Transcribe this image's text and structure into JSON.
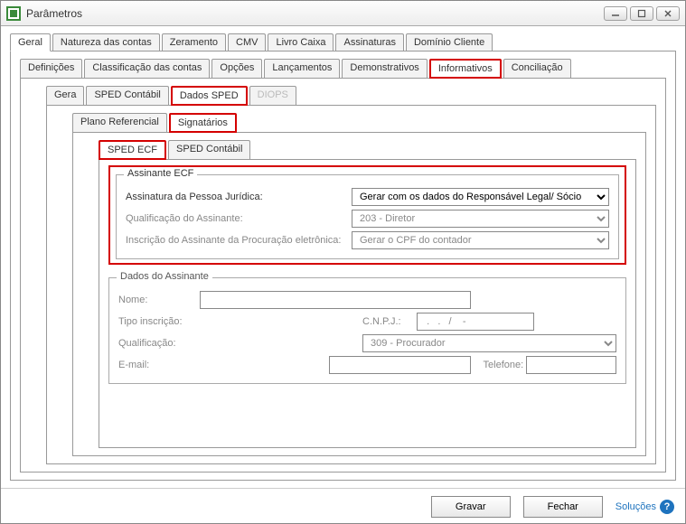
{
  "window": {
    "title": "Parâmetros"
  },
  "top_tabs": {
    "geral": "Geral",
    "natureza": "Natureza das contas",
    "zeramento": "Zeramento",
    "cmv": "CMV",
    "livro_caixa": "Livro Caixa",
    "assinaturas": "Assinaturas",
    "dominio_cliente": "Domínio Cliente"
  },
  "sub_tabs": {
    "definicoes": "Definições",
    "classificacao": "Classificação das contas",
    "opcoes": "Opções",
    "lancamentos": "Lançamentos",
    "demonstrativos": "Demonstrativos",
    "informativos": "Informativos",
    "conciliacao": "Conciliação"
  },
  "lvl3_tabs": {
    "gera": "Gera",
    "sped_contabil": "SPED Contábil",
    "dados_sped": "Dados SPED",
    "diops": "DIOPS"
  },
  "lvl4_tabs": {
    "plano_ref": "Plano Referencial",
    "signatarios": "Signatários"
  },
  "lvl5_tabs": {
    "sped_ecf": "SPED ECF",
    "sped_contabil": "SPED Contábil"
  },
  "group_assinante_ecf": {
    "legend": "Assinante ECF",
    "assinatura_pj_label": "Assinatura da Pessoa Jurídica:",
    "assinatura_pj_value": "Gerar com os dados do Responsável Legal/ Sócio",
    "qualificacao_label": "Qualificação do Assinante:",
    "qualificacao_value": "203 - Diretor",
    "inscricao_label": "Inscrição do Assinante da Procuração eletrônica:",
    "inscricao_value": "Gerar o CPF do contador"
  },
  "group_dados_assinante": {
    "legend": "Dados do Assinante",
    "nome_label": "Nome:",
    "nome_value": "",
    "tipo_inscricao_label": "Tipo inscrição:",
    "tipo_inscricao_value": "",
    "cnpj_label": "C.N.P.J.:",
    "cnpj_value": "  .   .   /    -  ",
    "qualificacao_label": "Qualificação:",
    "qualificacao_value": "309 - Procurador",
    "email_label": "E-mail:",
    "email_value": "",
    "telefone_label": "Telefone:",
    "telefone_value": ""
  },
  "buttons": {
    "gravar": "Gravar",
    "fechar": "Fechar",
    "solucoes": "Soluções"
  }
}
